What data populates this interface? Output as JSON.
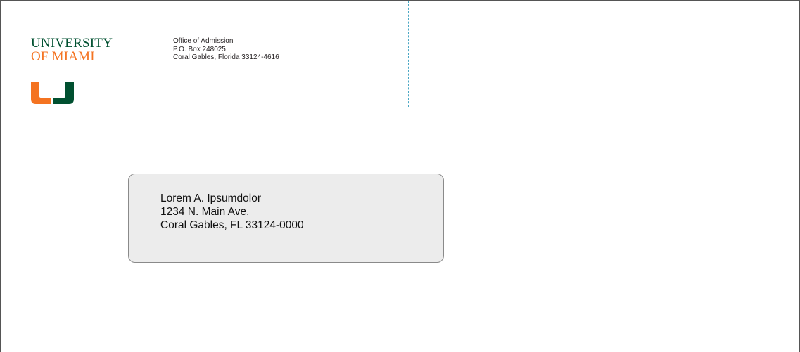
{
  "sender": {
    "wordmark_line1": "UNIVERSITY",
    "wordmark_line2": "OF MIAMI",
    "office": "Office of Admission",
    "po_box": "P.O. Box 248025",
    "city_state_zip": "Coral Gables, Florida 33124-4616"
  },
  "recipient": {
    "name": "Lorem A. Ipsumdolor",
    "street": "1234 N. Main Ave.",
    "city_state_zip": "Coral Gables, FL 33124-0000"
  },
  "colors": {
    "brand_green": "#005030",
    "brand_orange": "#f47321",
    "guide_line": "#4aa7c4",
    "window_fill": "#ececec",
    "window_border": "#8a8a8a"
  },
  "icons": {
    "logo": "u-split-logo-icon"
  }
}
